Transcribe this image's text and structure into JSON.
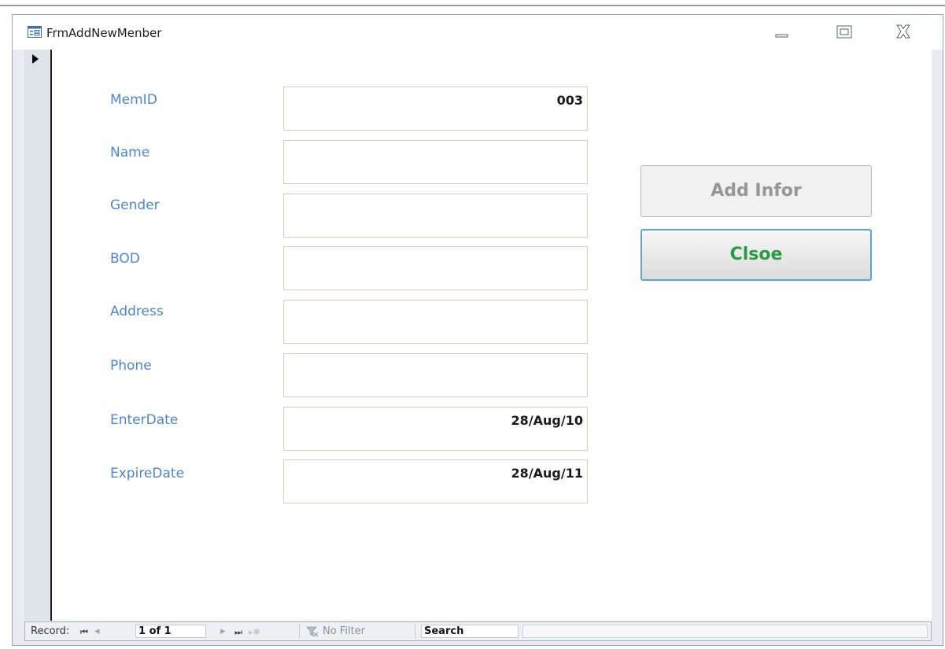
{
  "window": {
    "title": "FrmAddNewMenber"
  },
  "fields": [
    {
      "label": "MemID",
      "value": "003"
    },
    {
      "label": "Name",
      "value": ""
    },
    {
      "label": "Gender",
      "value": ""
    },
    {
      "label": "BOD",
      "value": ""
    },
    {
      "label": "Address",
      "value": ""
    },
    {
      "label": "Phone",
      "value": ""
    },
    {
      "label": "EnterDate",
      "value": "28/Aug/10"
    },
    {
      "label": "ExpireDate",
      "value": "28/Aug/11"
    }
  ],
  "buttons": {
    "add_label": "Add Infor",
    "close_label": "Clsoe"
  },
  "navbar": {
    "record_label": "Record:",
    "first_glyph": "⏮",
    "prev_glyph": "◂",
    "counter": "1 of 1",
    "next_glyph": "▸",
    "last_glyph": "⏭",
    "new_glyph": "▸✱",
    "filter_label": "No Filter",
    "search_label": "Search"
  },
  "colors": {
    "label_blue": "#4d86cf",
    "close_green": "#2a9a44",
    "focus_border": "#5da4d1"
  }
}
